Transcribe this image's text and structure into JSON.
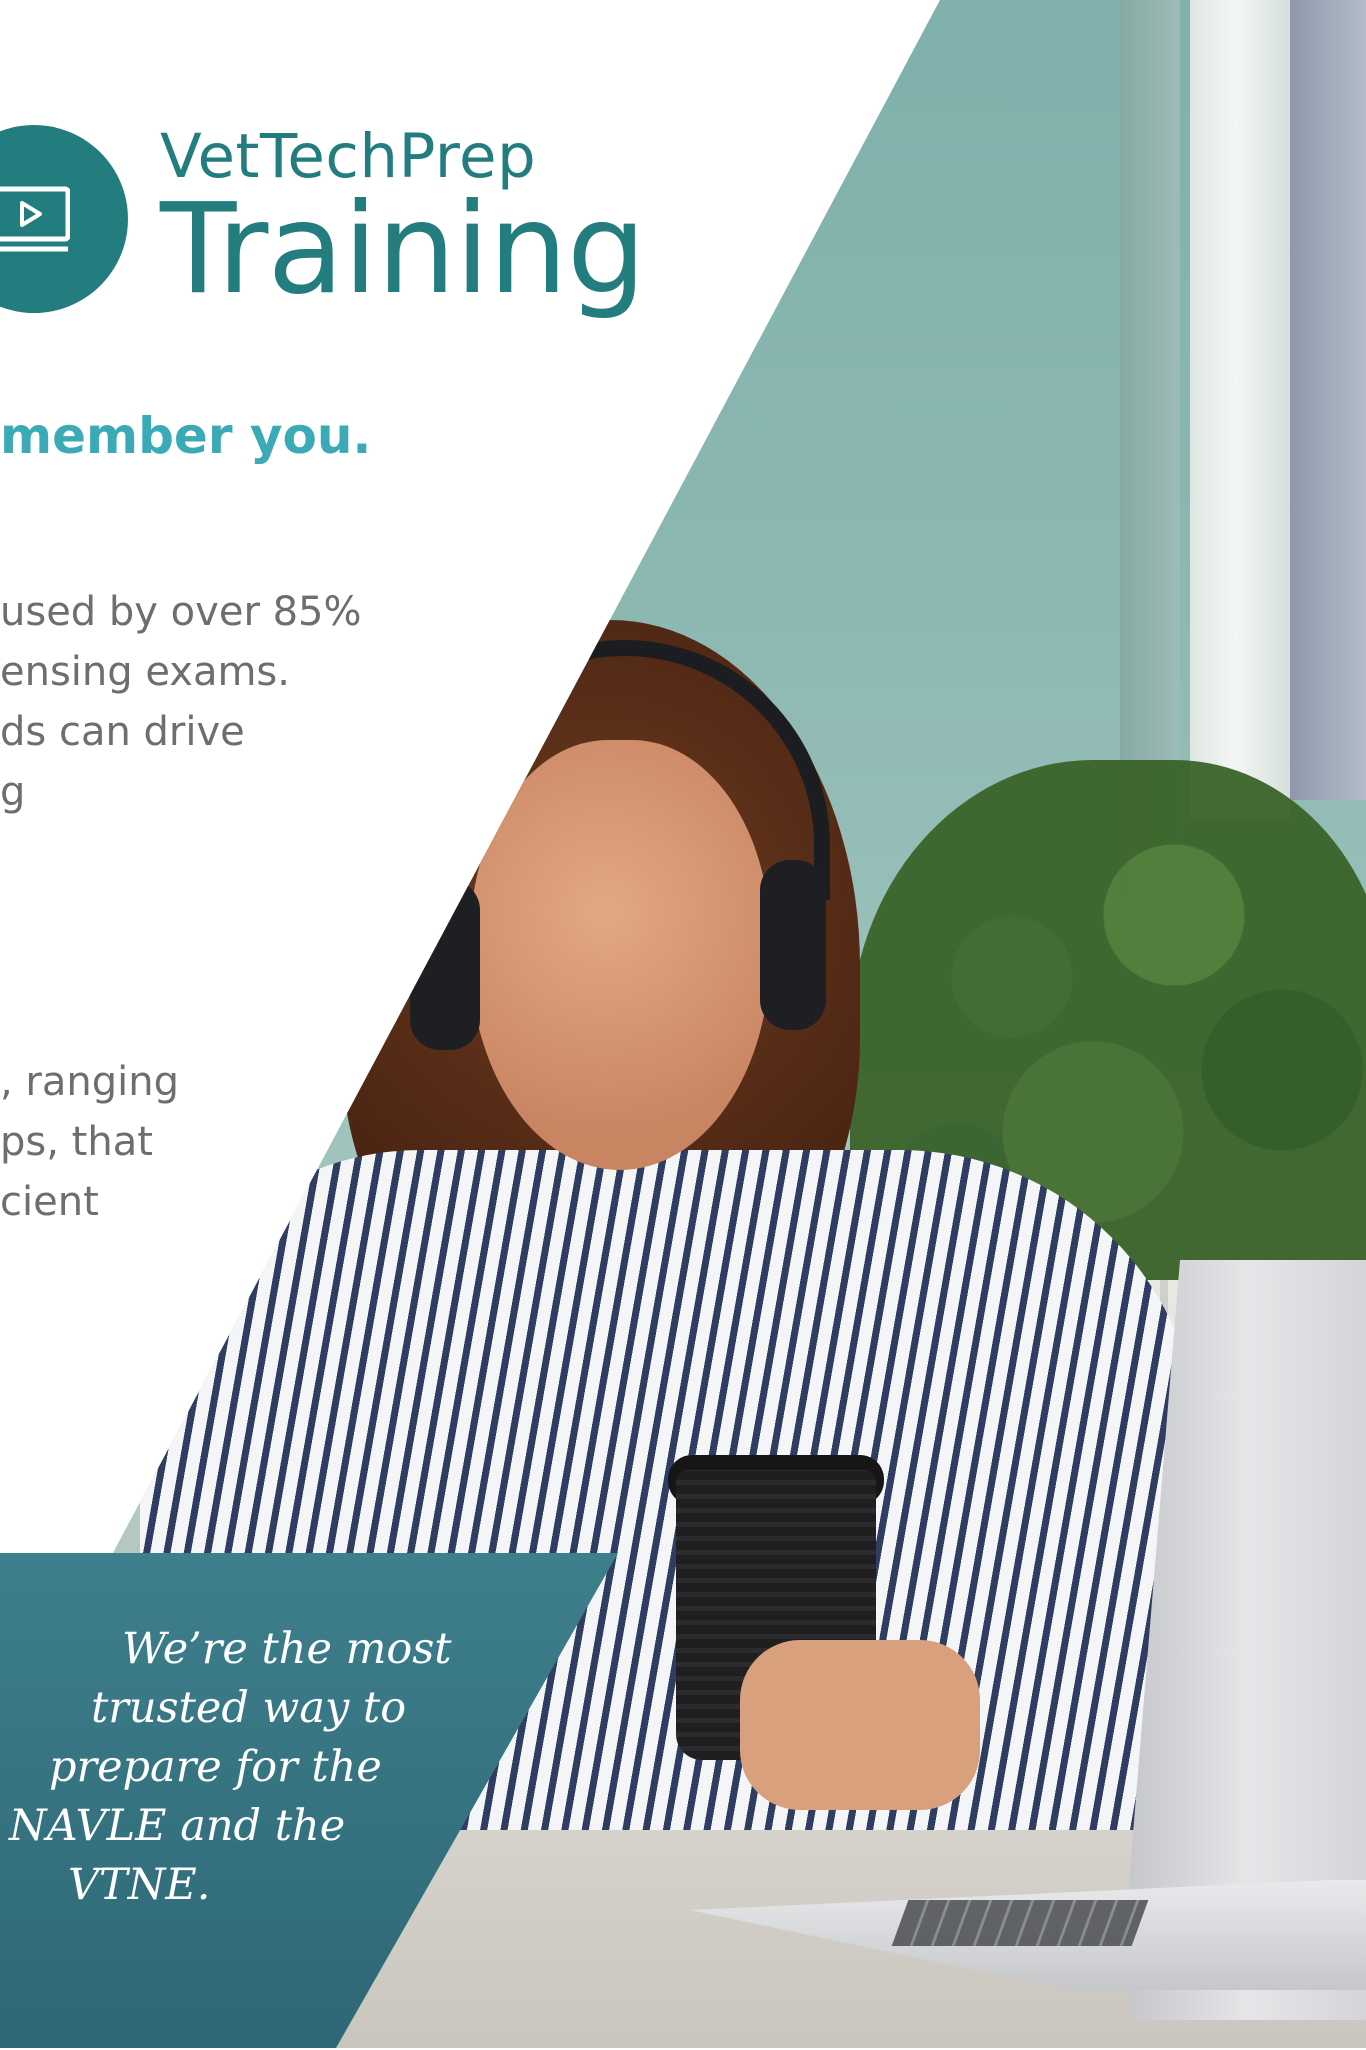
{
  "brand": {
    "line1": "VetTechPrep",
    "line2": "Training",
    "icon": "video-screen-icon",
    "color": "#237d7e"
  },
  "headline": "member you.",
  "paragraph1": [
    "used by over 85%",
    "ensing exams.",
    "ds can drive",
    "g"
  ],
  "paragraph2": [
    ", ranging",
    "ps, that",
    "cient"
  ],
  "quote": [
    "We’re the most",
    "trusted way to",
    "prepare for the",
    "NAVLE and the",
    "VTNE."
  ],
  "colors": {
    "headline": "#3aaab7",
    "body_text": "#6e6e72",
    "quote_panel": "#3e7f8c"
  }
}
